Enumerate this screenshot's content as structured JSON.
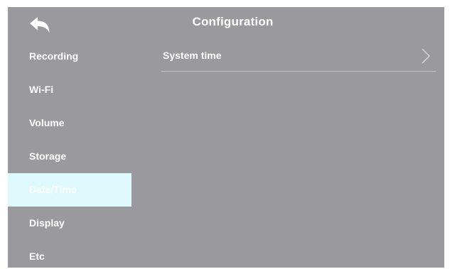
{
  "colors": {
    "panel_background": "#9a999e",
    "active_item_background": "#ddf9fb",
    "text": "#ffffff",
    "divider": "#c2c1c5"
  },
  "header": {
    "back_icon": "back-arrow-icon",
    "title": "Configuration"
  },
  "sidebar": {
    "active_index": 4,
    "items": [
      {
        "label": "Recording"
      },
      {
        "label": "Wi-Fi"
      },
      {
        "label": "Volume"
      },
      {
        "label": "Storage"
      },
      {
        "label": "Date/Time"
      },
      {
        "label": "Display"
      },
      {
        "label": "Etc"
      }
    ]
  },
  "content": {
    "rows": [
      {
        "label": "System time",
        "icon": "chevron-right-icon"
      }
    ]
  }
}
